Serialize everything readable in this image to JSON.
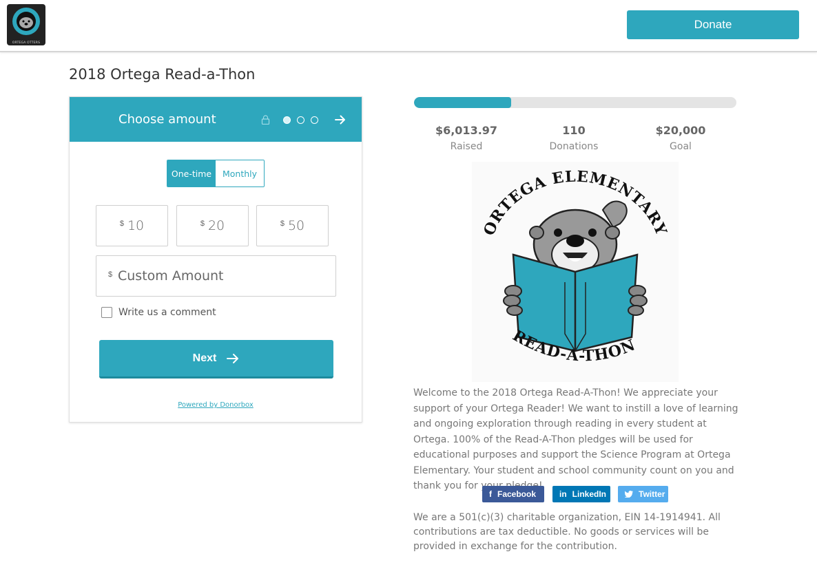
{
  "header": {
    "logo_caption": "ORTEGA OTTERS",
    "donate_label": "Donate"
  },
  "page_title": "2018 Ortega Read-a-Thon",
  "form": {
    "header_title": "Choose amount",
    "frequency": {
      "one_time": "One-time",
      "monthly": "Monthly",
      "selected": "One-time"
    },
    "currency_symbol": "$",
    "amounts": [
      "10",
      "20",
      "50"
    ],
    "custom_amount_placeholder": "Custom Amount",
    "comment_label": "Write us a comment",
    "next_label": "Next",
    "powered_by": "Powered by Donorbox",
    "steps": {
      "current": 1,
      "total": 3
    }
  },
  "campaign": {
    "progress_fraction": 0.3007,
    "stats": [
      {
        "value": "$6,013.97",
        "label": "Raised"
      },
      {
        "value": "110",
        "label": "Donations"
      },
      {
        "value": "$20,000",
        "label": "Goal"
      }
    ],
    "image": {
      "arc_top": "ORTEGA ELEMENTARY",
      "arc_bottom": "READ-A-THON"
    },
    "description": "Welcome to the 2018 Ortega Read-A-Thon!  We appreciate your support of your Ortega Reader!  We want to instill a love of learning and ongoing exploration through reading in every student at Ortega.  100% of the Read-A-Thon pledges will be used for educational purposes and support the Science Program at Ortega Elementary. Your student and school community count on you and thank you for your pledge!",
    "share": {
      "facebook": "Facebook",
      "linkedin": "LinkedIn",
      "twitter": "Twitter"
    },
    "legal": "We are a 501(c)(3) charitable organization, EIN 14-1914941. All contributions are tax deductible. No goods or services will be provided in exchange for the contribution."
  },
  "colors": {
    "accent": "#2ea7bd",
    "facebook": "#3b5998",
    "linkedin": "#0077b5",
    "twitter": "#55acee"
  }
}
